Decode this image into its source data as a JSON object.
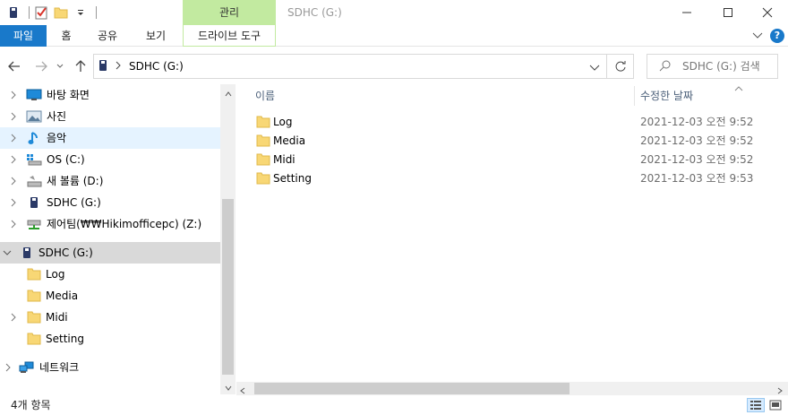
{
  "window": {
    "title": "SDHC (G:)",
    "context_tab_header": "관리"
  },
  "ribbon": {
    "tabs": [
      {
        "label": "파일"
      },
      {
        "label": "홈"
      },
      {
        "label": "공유"
      },
      {
        "label": "보기"
      },
      {
        "label": "드라이브 도구"
      }
    ]
  },
  "address": {
    "path": "SDHC (G:)",
    "search_placeholder": "SDHC (G:) 검색"
  },
  "nav": {
    "items": [
      {
        "label": "바탕 화면",
        "icon": "desktop-icon"
      },
      {
        "label": "사진",
        "icon": "pictures-icon"
      },
      {
        "label": "음악",
        "icon": "music-icon"
      },
      {
        "label": "OS (C:)",
        "icon": "windows-drive-icon"
      },
      {
        "label": "새 볼륨 (D:)",
        "icon": "drive-icon"
      },
      {
        "label": "SDHC (G:)",
        "icon": "sd-card-icon"
      },
      {
        "label": "제어팀(₩₩Hikimofficepc) (Z:)",
        "icon": "network-drive-icon"
      },
      {
        "label": "SDHC (G:)",
        "icon": "sd-card-icon"
      },
      {
        "label": "Log",
        "icon": "folder-icon"
      },
      {
        "label": "Media",
        "icon": "folder-icon"
      },
      {
        "label": "Midi",
        "icon": "folder-icon"
      },
      {
        "label": "Setting",
        "icon": "folder-icon"
      },
      {
        "label": "네트워크",
        "icon": "network-icon"
      }
    ]
  },
  "columns": {
    "name": "이름",
    "modified": "수정한 날짜"
  },
  "files": [
    {
      "name": "Log",
      "modified": "2021-12-03 오전 9:52"
    },
    {
      "name": "Media",
      "modified": "2021-12-03 오전 9:52"
    },
    {
      "name": "Midi",
      "modified": "2021-12-03 오전 9:52"
    },
    {
      "name": "Setting",
      "modified": "2021-12-03 오전 9:53"
    }
  ],
  "status": {
    "item_count": "4개 항목"
  },
  "colors": {
    "file_tab": "#1979ca",
    "context_tab": "#c2eaa0",
    "folder": "#f8d775",
    "hover": "#e5f3ff",
    "selected": "#d9d9d9"
  }
}
